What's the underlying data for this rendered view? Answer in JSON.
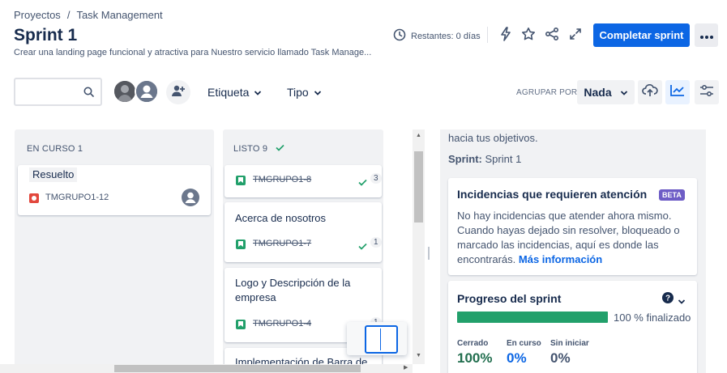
{
  "breadcrumb": {
    "project": "Proyectos",
    "separator": "/",
    "page": "Task Management"
  },
  "header": {
    "title": "Sprint 1",
    "description": "Crear una landing page funcional y atractiva para Nuestro servicio llamado Task Manage...",
    "remaining": "Restantes: 0 días",
    "complete_label": "Completar sprint"
  },
  "toolbar": {
    "search_value": "",
    "filter_label_1": "Etiqueta",
    "filter_label_2": "Tipo",
    "group_by_label": "AGRUPAR POR",
    "group_by_value": "Nada"
  },
  "board": {
    "columns": [
      {
        "title": "EN CURSO 1",
        "cards": [
          {
            "title": "Resuelto",
            "key": "TMGRUPO1-12"
          }
        ]
      },
      {
        "title": "LISTO 9",
        "cards": [
          {
            "key": "TMGRUPO1-8",
            "count": "3"
          },
          {
            "title": "Acerca de nosotros",
            "key": "TMGRUPO1-7",
            "count": "1"
          },
          {
            "title": "Logo y Descripción de la empresa",
            "key": "TMGRUPO1-4",
            "count": "1"
          },
          {
            "title": "Implementación de Barra de"
          }
        ]
      }
    ]
  },
  "panel": {
    "goal_text": "hacia tus objetivos.",
    "sprint_label": "Sprint:",
    "sprint_value": "Sprint 1",
    "attention": {
      "title": "Incidencias que requieren atención",
      "badge": "BETA",
      "body": "No hay incidencias que atender ahora mismo. Cuando hayas dejado sin resolver, bloqueado o marcado las incidencias, aquí es donde las encontrarás.",
      "link": "Más información"
    },
    "progress": {
      "title": "Progreso del sprint",
      "percent": 100,
      "percent_label": "100 % finalizado",
      "stats": [
        {
          "label": "Cerrado",
          "value": "100%"
        },
        {
          "label": "En curso",
          "value": "0%"
        },
        {
          "label": "Sin iniciar",
          "value": "0%"
        }
      ]
    }
  },
  "colors": {
    "primary": "#0c66e4",
    "done_green": "#22a06b",
    "closed_text": "#216e4e",
    "beta": "#6e5dc6",
    "bug_red": "#e2483d"
  },
  "icons": [
    "clock-icon",
    "lightning-icon",
    "star-icon",
    "share-icon",
    "expand-icon",
    "more-icon",
    "search-icon",
    "add-person-icon",
    "chevron-down-icon",
    "cloud-upload-icon",
    "chart-icon",
    "settings-sliders-icon",
    "check-icon",
    "help-icon",
    "story-icon",
    "bug-icon"
  ]
}
